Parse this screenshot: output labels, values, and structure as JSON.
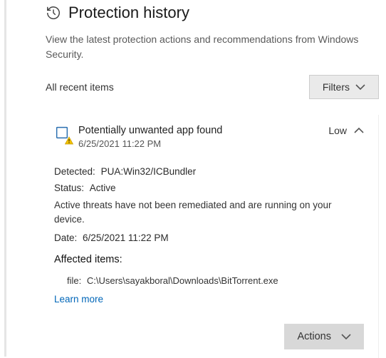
{
  "header": {
    "title": "Protection history",
    "subtitle": "View the latest protection actions and recommendations from Windows Security."
  },
  "section": {
    "title": "All recent items",
    "filters_label": "Filters"
  },
  "card": {
    "title": "Potentially unwanted app found",
    "timestamp": "6/25/2021 11:22 PM",
    "severity": "Low",
    "details": {
      "detected_label": "Detected:",
      "detected_value": "PUA:Win32/ICBundler",
      "status_label": "Status:",
      "status_value": "Active",
      "note": "Active threats have not been remediated and are running on your device.",
      "date_label": "Date:",
      "date_value": "6/25/2021 11:22 PM",
      "affected_title": "Affected items:",
      "file_label": "file:",
      "file_path": "C:\\Users\\sayakboral\\Downloads\\BitTorrent.exe",
      "learn_more": "Learn more"
    },
    "actions_label": "Actions"
  }
}
